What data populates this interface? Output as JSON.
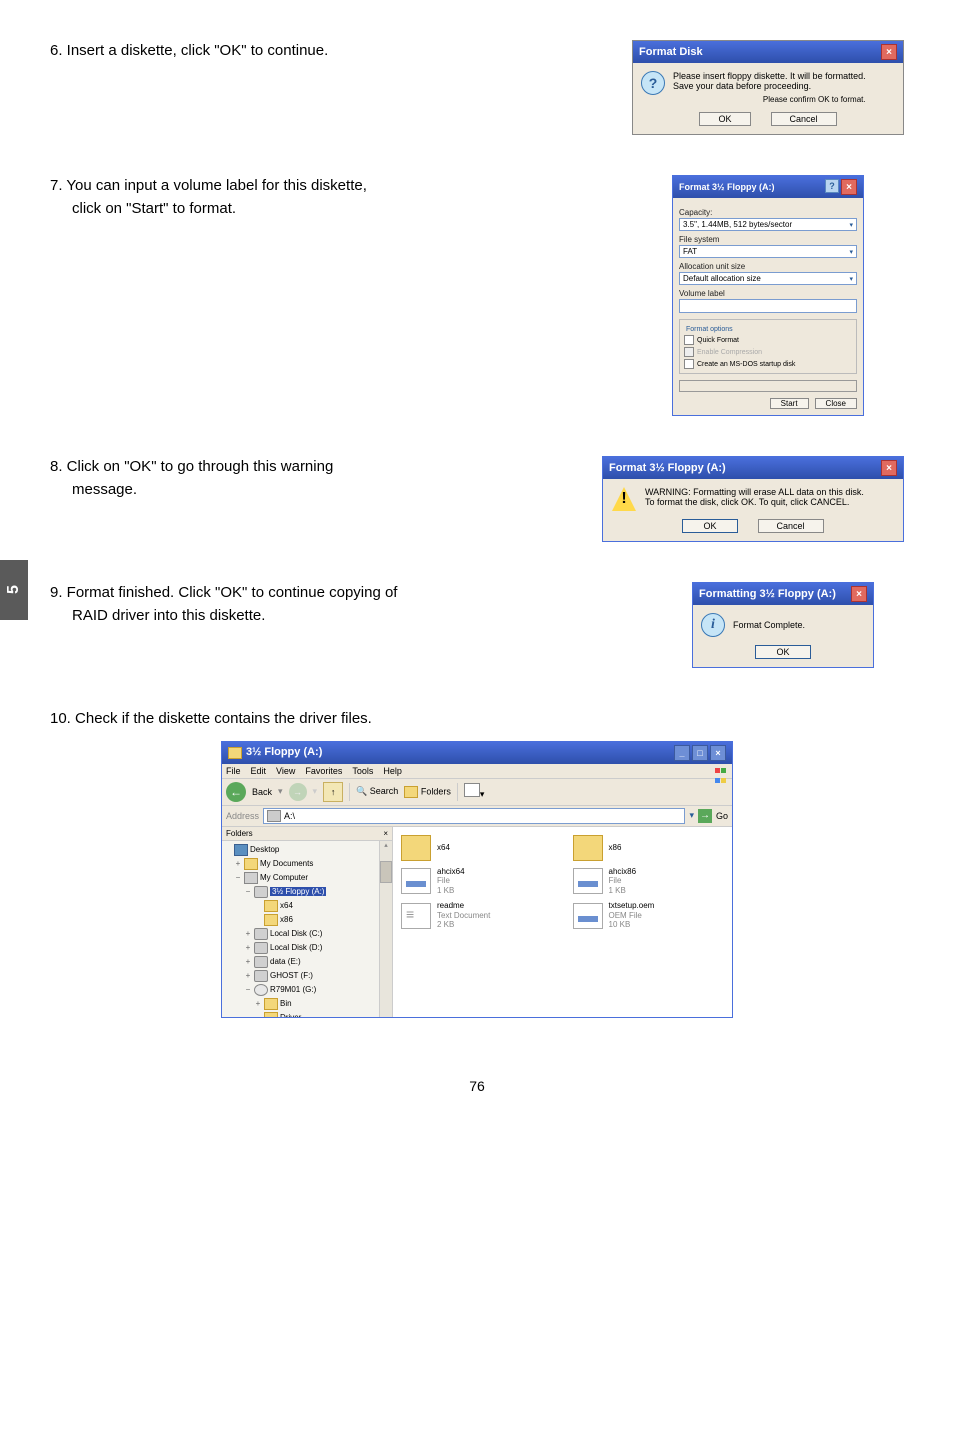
{
  "page_tab": "5",
  "page_number": "76",
  "steps": {
    "s6": "6. Insert a diskette, click \"OK\" to continue.",
    "s7a": "7. You can input a volume label for this diskette,",
    "s7b": "click on \"Start\" to format.",
    "s8a": "8. Click on \"OK\" to go through this warning",
    "s8b": "message.",
    "s9a": "9. Format finished. Click \"OK\" to continue copying of",
    "s9b": "RAID driver into this diskette.",
    "s10": "10. Check if the diskette contains the driver files."
  },
  "dlg6": {
    "title": "Format Disk",
    "msg1": "Please insert floppy diskette.  It will be formatted.",
    "msg2": "Save your data before proceeding.",
    "msg3": "Please confirm OK to format.",
    "ok": "OK",
    "cancel": "Cancel"
  },
  "dlg7": {
    "title": "Format 3½ Floppy (A:)",
    "cap_l": "Capacity:",
    "cap_v": "3.5\", 1.44MB, 512 bytes/sector",
    "fs_l": "File system",
    "fs_v": "FAT",
    "au_l": "Allocation unit size",
    "au_v": "Default allocation size",
    "vl_l": "Volume label",
    "opts": "Format options",
    "qf": "Quick Format",
    "ec": "Enable Compression",
    "ms": "Create an MS-DOS startup disk",
    "start": "Start",
    "close": "Close"
  },
  "dlg8": {
    "title": "Format 3½ Floppy (A:)",
    "msg1": "WARNING: Formatting will erase ALL data on this disk.",
    "msg2": "To format the disk, click OK. To quit, click CANCEL.",
    "ok": "OK",
    "cancel": "Cancel"
  },
  "dlg9": {
    "title": "Formatting 3½ Floppy (A:)",
    "msg": "Format Complete.",
    "ok": "OK"
  },
  "explorer": {
    "title": "3½ Floppy (A:)",
    "menu": [
      "File",
      "Edit",
      "View",
      "Favorites",
      "Tools",
      "Help"
    ],
    "back": "Back",
    "search": "Search",
    "folders": "Folders",
    "addr_l": "Address",
    "addr_v": "A:\\",
    "go": "Go",
    "side_head": "Folders",
    "tree": [
      {
        "toggle": "",
        "pad": 0,
        "icon": "desk",
        "label": "Desktop"
      },
      {
        "toggle": "+",
        "pad": 1,
        "icon": "fold",
        "label": "My Documents"
      },
      {
        "toggle": "−",
        "pad": 1,
        "icon": "comp",
        "label": "My Computer"
      },
      {
        "toggle": "−",
        "pad": 2,
        "icon": "flop",
        "label": "3½ Floppy (A:)",
        "sel": true
      },
      {
        "toggle": "",
        "pad": 3,
        "icon": "fold",
        "label": "x64"
      },
      {
        "toggle": "",
        "pad": 3,
        "icon": "fold",
        "label": "x86"
      },
      {
        "toggle": "+",
        "pad": 2,
        "icon": "drv",
        "label": "Local Disk (C:)"
      },
      {
        "toggle": "+",
        "pad": 2,
        "icon": "drv",
        "label": "Local Disk (D:)"
      },
      {
        "toggle": "+",
        "pad": 2,
        "icon": "drv",
        "label": "data (E:)"
      },
      {
        "toggle": "+",
        "pad": 2,
        "icon": "drv",
        "label": "GHOST (F:)"
      },
      {
        "toggle": "−",
        "pad": 2,
        "icon": "cd",
        "label": "R79M01 (G:)"
      },
      {
        "toggle": "+",
        "pad": 3,
        "icon": "fold",
        "label": "Bin"
      },
      {
        "toggle": "−",
        "pad": 3,
        "icon": "fold",
        "label": "Driver"
      }
    ],
    "files": [
      {
        "icon": "fold",
        "name": "x64",
        "d1": "",
        "d2": ""
      },
      {
        "icon": "fold",
        "name": "x86",
        "d1": "",
        "d2": ""
      },
      {
        "icon": "sys",
        "name": "ahcix64",
        "d1": "File",
        "d2": "1 KB"
      },
      {
        "icon": "sys",
        "name": "ahcix86",
        "d1": "File",
        "d2": "1 KB"
      },
      {
        "icon": "txt",
        "name": "readme",
        "d1": "Text Document",
        "d2": "2 KB"
      },
      {
        "icon": "sys",
        "name": "txtsetup.oem",
        "d1": "OEM File",
        "d2": "10 KB"
      }
    ]
  }
}
